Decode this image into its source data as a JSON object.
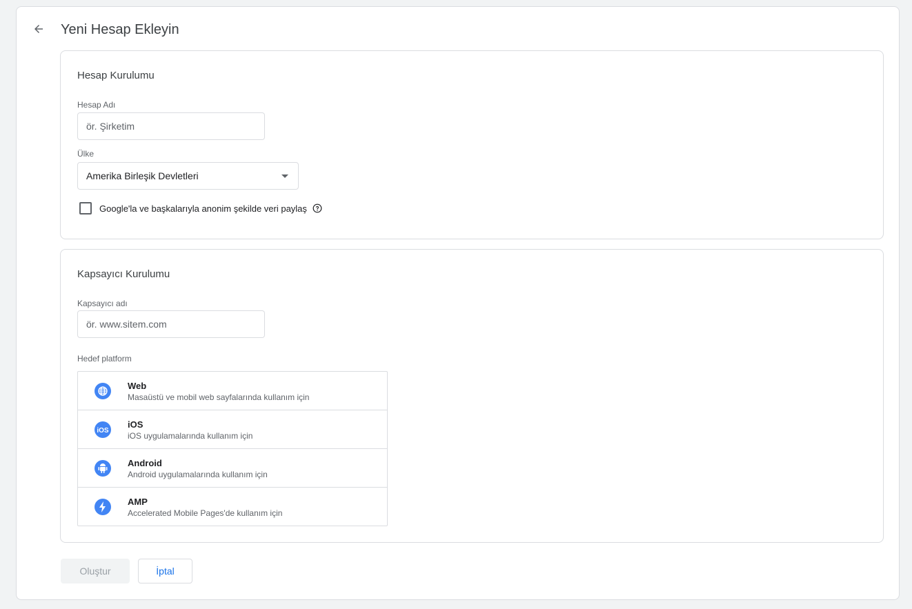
{
  "header": {
    "title": "Yeni Hesap Ekleyin"
  },
  "account_setup": {
    "title": "Hesap Kurulumu",
    "account_name_label": "Hesap Adı",
    "account_name_placeholder": "ör. Şirketim",
    "account_name_value": "",
    "country_label": "Ülke",
    "country_value": "Amerika Birleşik Devletleri",
    "share_data_label": "Google'la ve başkalarıyla anonim şekilde veri paylaş",
    "share_data_checked": false
  },
  "container_setup": {
    "title": "Kapsayıcı Kurulumu",
    "container_name_label": "Kapsayıcı adı",
    "container_name_placeholder": "ör. www.sitem.com",
    "container_name_value": "",
    "target_platform_label": "Hedef platform",
    "platforms": [
      {
        "name": "Web",
        "description": "Masaüstü ve mobil web sayfalarında kullanım için",
        "icon": "globe-icon"
      },
      {
        "name": "iOS",
        "description": "iOS uygulamalarında kullanım için",
        "icon": "ios-icon"
      },
      {
        "name": "Android",
        "description": "Android uygulamalarında kullanım için",
        "icon": "android-icon"
      },
      {
        "name": "AMP",
        "description": "Accelerated Mobile Pages'de kullanım için",
        "icon": "lightning-icon"
      }
    ]
  },
  "actions": {
    "create_label": "Oluştur",
    "cancel_label": "İptal"
  },
  "colors": {
    "accent": "#1a73e8",
    "platform_icon_bg": "#4285f4",
    "border": "#dadce0",
    "background": "#f1f3f4"
  }
}
